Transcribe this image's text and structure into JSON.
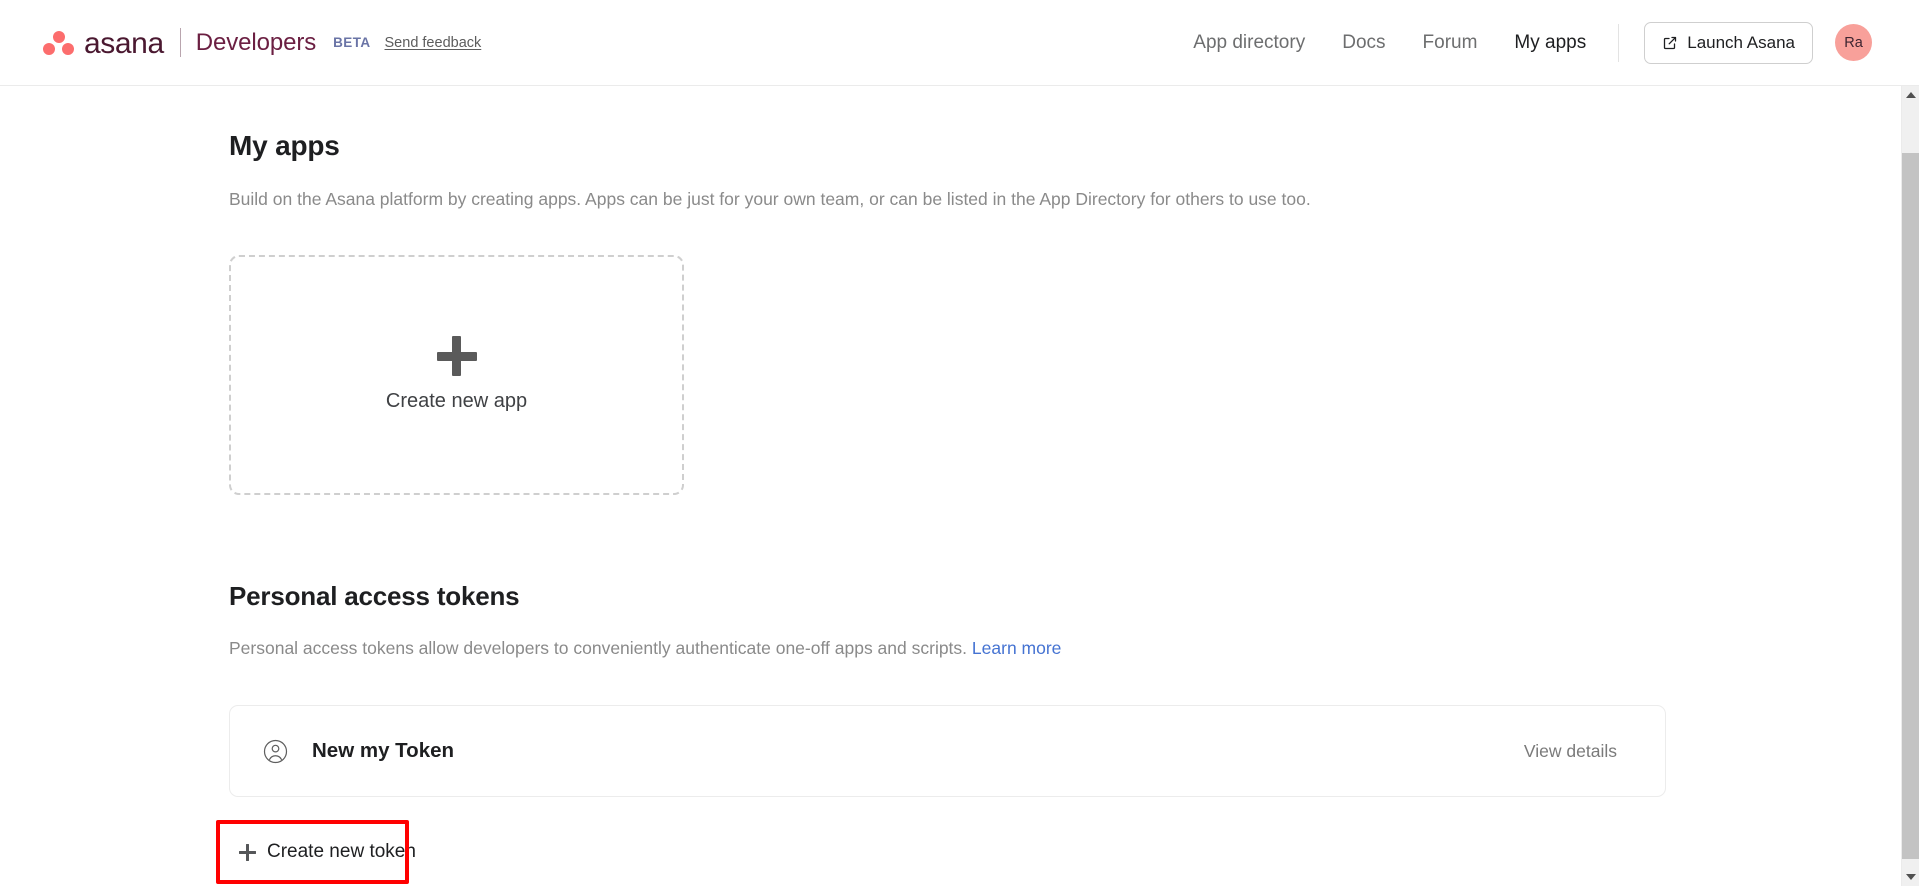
{
  "header": {
    "logo_text": "asana",
    "logo_icon": "asana-three-dots-icon",
    "product_name": "Developers",
    "beta_label": "BETA",
    "feedback_label": "Send feedback",
    "nav": [
      {
        "label": "App directory",
        "active": false
      },
      {
        "label": "Docs",
        "active": false
      },
      {
        "label": "Forum",
        "active": false
      },
      {
        "label": "My apps",
        "active": true
      }
    ],
    "launch_button": {
      "label": "Launch Asana",
      "icon": "external-link-icon"
    },
    "avatar": {
      "initials": "Ra",
      "color": "#f8a09a"
    }
  },
  "main": {
    "apps": {
      "title": "My apps",
      "description": "Build on the Asana platform by creating apps. Apps can be just for your own team, or can be listed in the App Directory for others to use too.",
      "create_card": {
        "icon": "plus-icon",
        "label": "Create new app"
      }
    },
    "tokens": {
      "title": "Personal access tokens",
      "description_before_link": "Personal access tokens allow developers to conveniently authenticate one-off apps and scripts.",
      "learn_more_label": "Learn more",
      "rows": [
        {
          "icon": "person-circle-icon",
          "name": "New my Token",
          "action_label": "View details"
        }
      ],
      "create_token": {
        "icon": "plus-icon",
        "label": "Create new token",
        "highlight_color": "#ff0000"
      }
    }
  },
  "scrollbar": {
    "up_icon": "chevron-up-icon",
    "down_icon": "chevron-down-icon"
  },
  "colors": {
    "brand_maroon": "#6b1f42",
    "logo_coral": "#fc6d6d",
    "link_blue": "#4573d2",
    "text_primary": "#1e1f21",
    "text_muted": "#8a8a8a",
    "annotation_red": "#ff0000"
  }
}
